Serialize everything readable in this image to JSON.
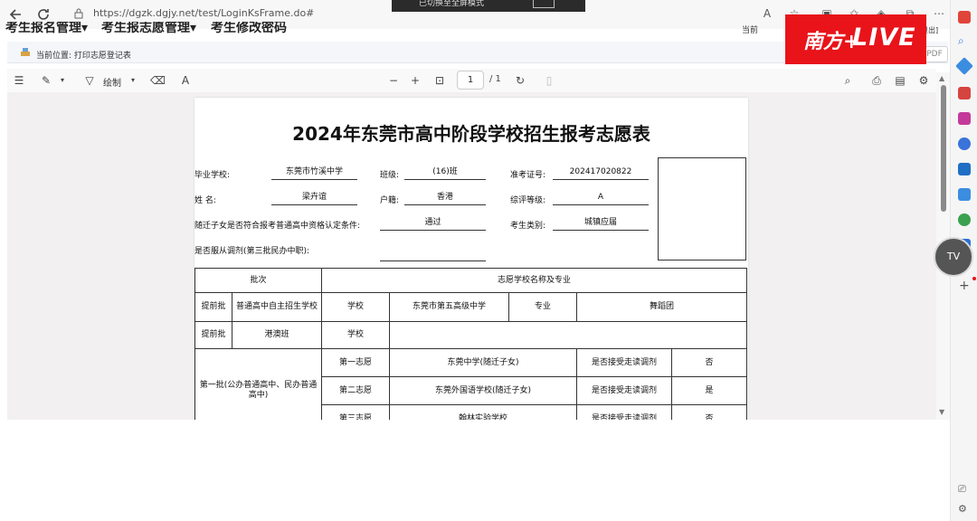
{
  "browser": {
    "url": "https://dgzk.dgjy.net/test/LoginKsFrame.do#",
    "toast": "已切换至全屏模式",
    "icons": [
      "back-icon",
      "refresh-icon",
      "lock-icon",
      "read-aloud-icon",
      "favorite-icon",
      "split-icon",
      "favorites-icon",
      "extensions-icon",
      "collections-icon",
      "more-icon"
    ]
  },
  "site": {
    "menus": [
      "考生报名管理▾",
      "考生报志愿管理▾",
      "考生修改密码"
    ],
    "header_right": "当前",
    "header_right2": "退出]",
    "logo_cn": "南方+",
    "logo_live": "LIVE"
  },
  "breadcrumb": {
    "text": "当前位置: 打印志愿登记表",
    "pdf_button": "PDF"
  },
  "pdf_toolbar": {
    "draw_label": "绘制",
    "page_current": "1",
    "page_total": "/ 1"
  },
  "form": {
    "title": "2024年东莞市高中阶段学校招生报考志愿表",
    "fields": {
      "school_label": "毕业学校:",
      "school_value": "东莞市竹溪中学",
      "class_label": "班级:",
      "class_value": "(16)班",
      "exam_no_label": "准考证号:",
      "exam_no_value": "202417020822",
      "name_label": "姓  名:",
      "name_value": "梁卉谊",
      "hukou_label": "户籍:",
      "hukou_value": "香港",
      "grade_label": "综评等级:",
      "grade_value": "A",
      "migrant_label": "随迁子女是否符合报考普通高中资格认定条件:",
      "migrant_value": "通过",
      "category_label": "考生类别:",
      "category_value": "城镇应届",
      "adjust_label": "是否服从调剂(第三批民办中职):",
      "adjust_value": ""
    },
    "table": {
      "header_batch": "批次",
      "header_wish": "志愿学校名称及专业",
      "early1_batch": "提前批",
      "early1_type": "普通高中自主招生学校",
      "early1_school_label": "学校",
      "early1_school": "东莞市第五高级中学",
      "early1_major_label": "专业",
      "early1_major": "舞蹈团",
      "early2_batch": "提前批",
      "early2_type": "港澳班",
      "early2_school_label": "学校",
      "early2_school": "",
      "batch1_name": "第一批(公办普通高中、民办普通高中)",
      "wishes": [
        {
          "order": "第一志愿",
          "school": "东莞中学(随迁子女)",
          "adjust_label": "是否接受走读调剂",
          "adjust": "否"
        },
        {
          "order": "第二志愿",
          "school": "东莞外国语学校(随迁子女)",
          "adjust_label": "是否接受走读调剂",
          "adjust": "是"
        },
        {
          "order": "第三志愿",
          "school": "翰林实验学校",
          "adjust_label": "是否接受走读调剂",
          "adjust": "否"
        }
      ]
    }
  },
  "sidebar": {
    "tv_label": "TV",
    "plus": "+",
    "colors": [
      "#e0453a",
      "#2f7be0",
      "#d6443f",
      "#c43a9a",
      "#3a73d9",
      "#1f6fc4",
      "#3b8de0",
      "#3aa150",
      "#2c6fd1"
    ]
  }
}
